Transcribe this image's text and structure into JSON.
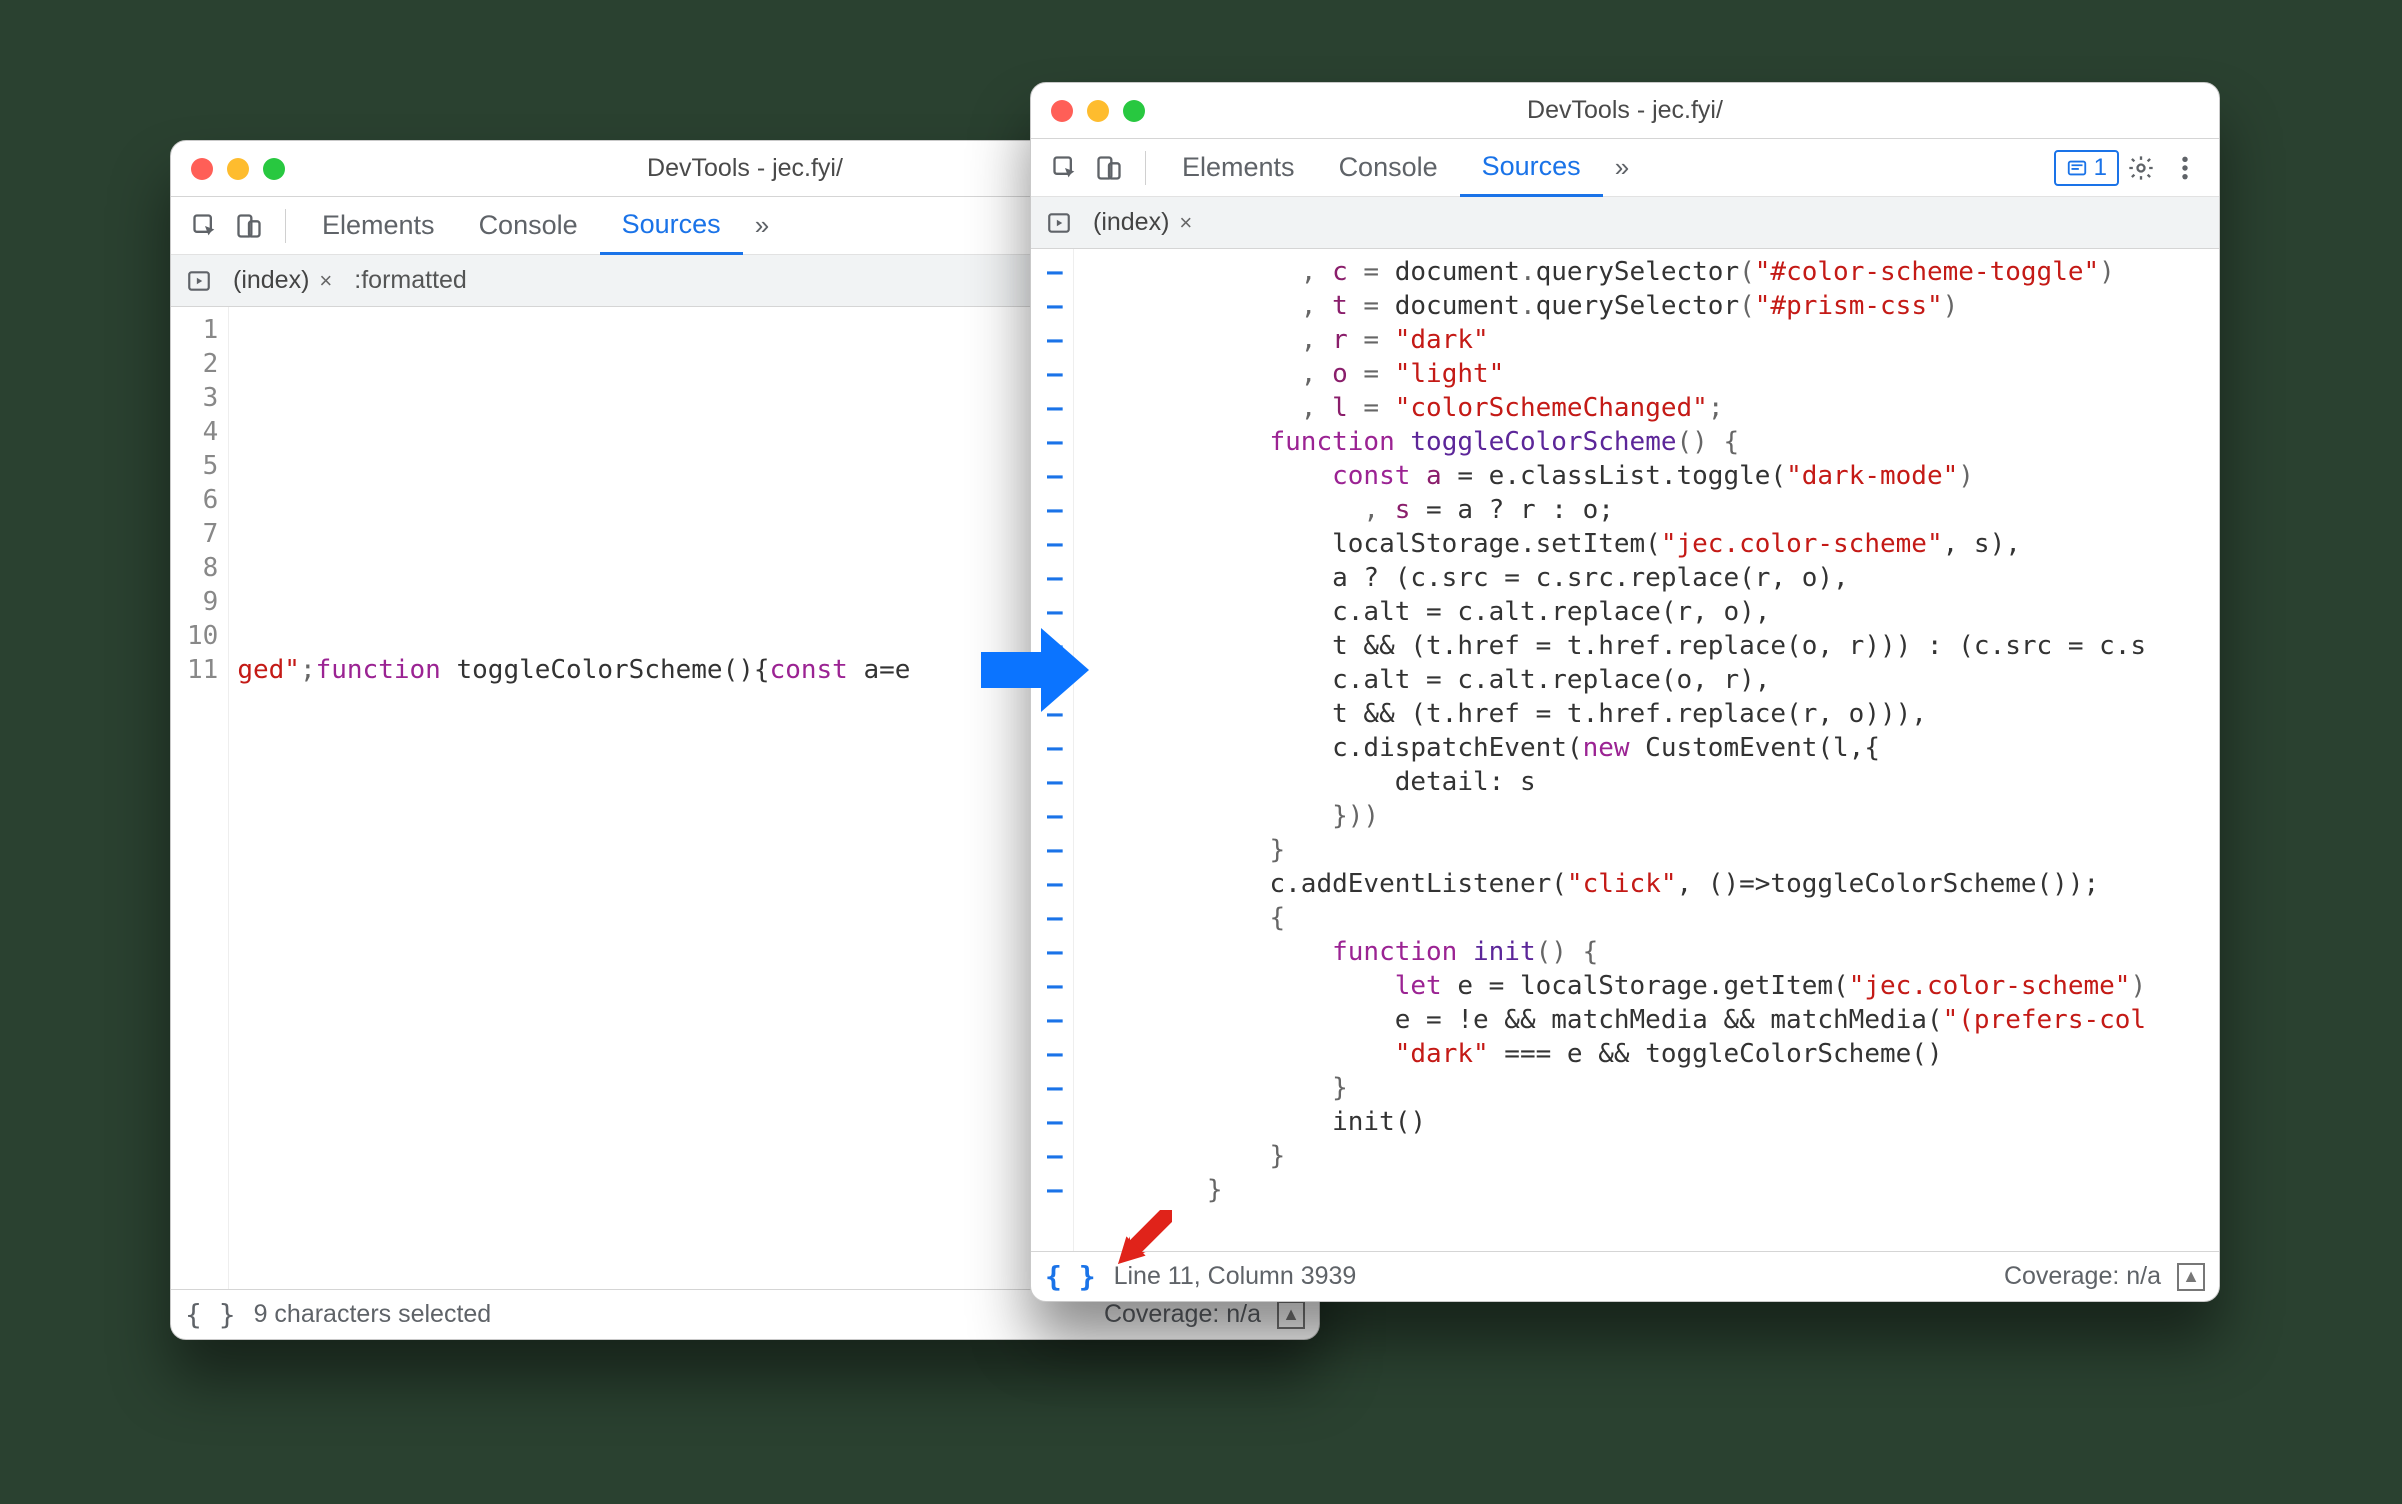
{
  "windowA": {
    "title": "DevTools - jec.fyi/",
    "tabs": {
      "elements": "Elements",
      "console": "Console",
      "sources": "Sources"
    },
    "files": {
      "index": "(index)",
      "formatted": ":formatted"
    },
    "gutter": [
      "1",
      "2",
      "3",
      "4",
      "5",
      "6",
      "7",
      "8",
      "9",
      "10",
      "11"
    ],
    "code_line11": {
      "a": "ged\"",
      "b": ";",
      "c": "function",
      "d": " toggleColorScheme(){",
      "e": "const",
      "f": " a=e"
    },
    "status": {
      "selection": "9 characters selected",
      "coverage": "Coverage: n/a"
    }
  },
  "windowB": {
    "title": "DevTools - jec.fyi/",
    "tabs": {
      "elements": "Elements",
      "console": "Console",
      "sources": "Sources"
    },
    "badge_count": "1",
    "files": {
      "index": "(index)"
    },
    "gutter_dash": "–",
    "code_lines": [
      [
        {
          "t": "              , ",
          "c": "tok-punc"
        },
        {
          "t": "c",
          "c": "tok-prop"
        },
        {
          "t": " = ",
          "c": "tok-punc"
        },
        {
          "t": "document",
          "c": "tok-id"
        },
        {
          "t": ".",
          "c": "tok-punc"
        },
        {
          "t": "querySelector",
          "c": "tok-id"
        },
        {
          "t": "(",
          "c": "tok-punc"
        },
        {
          "t": "\"#color-scheme-toggle\"",
          "c": "tok-str"
        },
        {
          "t": ")",
          "c": "tok-punc"
        }
      ],
      [
        {
          "t": "              , ",
          "c": "tok-punc"
        },
        {
          "t": "t",
          "c": "tok-prop"
        },
        {
          "t": " = ",
          "c": "tok-punc"
        },
        {
          "t": "document",
          "c": "tok-id"
        },
        {
          "t": ".",
          "c": "tok-punc"
        },
        {
          "t": "querySelector",
          "c": "tok-id"
        },
        {
          "t": "(",
          "c": "tok-punc"
        },
        {
          "t": "\"#prism-css\"",
          "c": "tok-str"
        },
        {
          "t": ")",
          "c": "tok-punc"
        }
      ],
      [
        {
          "t": "              , ",
          "c": "tok-punc"
        },
        {
          "t": "r",
          "c": "tok-prop"
        },
        {
          "t": " = ",
          "c": "tok-punc"
        },
        {
          "t": "\"dark\"",
          "c": "tok-str"
        }
      ],
      [
        {
          "t": "              , ",
          "c": "tok-punc"
        },
        {
          "t": "o",
          "c": "tok-prop"
        },
        {
          "t": " = ",
          "c": "tok-punc"
        },
        {
          "t": "\"light\"",
          "c": "tok-str"
        }
      ],
      [
        {
          "t": "              , ",
          "c": "tok-punc"
        },
        {
          "t": "l",
          "c": "tok-prop"
        },
        {
          "t": " = ",
          "c": "tok-punc"
        },
        {
          "t": "\"colorSchemeChanged\"",
          "c": "tok-str"
        },
        {
          "t": ";",
          "c": "tok-punc"
        }
      ],
      [
        {
          "t": "            ",
          "c": "tok-punc"
        },
        {
          "t": "function",
          "c": "tok-kw"
        },
        {
          "t": " ",
          "c": ""
        },
        {
          "t": "toggleColorScheme",
          "c": "tok-fn"
        },
        {
          "t": "() {",
          "c": "tok-punc"
        }
      ],
      [
        {
          "t": "                ",
          "c": ""
        },
        {
          "t": "const",
          "c": "tok-kw"
        },
        {
          "t": " ",
          "c": ""
        },
        {
          "t": "a",
          "c": "tok-prop"
        },
        {
          "t": " = e.classList.toggle(",
          "c": "tok-id"
        },
        {
          "t": "\"dark-mode\"",
          "c": "tok-str"
        },
        {
          "t": ")",
          "c": "tok-punc"
        }
      ],
      [
        {
          "t": "                  , ",
          "c": "tok-punc"
        },
        {
          "t": "s",
          "c": "tok-prop"
        },
        {
          "t": " = a ? r : o;",
          "c": "tok-id"
        }
      ],
      [
        {
          "t": "                localStorage.setItem(",
          "c": "tok-id"
        },
        {
          "t": "\"jec.color-scheme\"",
          "c": "tok-str"
        },
        {
          "t": ", s),",
          "c": "tok-id"
        }
      ],
      [
        {
          "t": "                a ? (c.src = c.src.replace(r, o),",
          "c": "tok-id"
        }
      ],
      [
        {
          "t": "                c.alt = c.alt.replace(r, o),",
          "c": "tok-id"
        }
      ],
      [
        {
          "t": "                t && (t.href = t.href.replace(o, r))) : (c.src = c.s",
          "c": "tok-id"
        }
      ],
      [
        {
          "t": "                c.alt = c.alt.replace(o, r),",
          "c": "tok-id"
        }
      ],
      [
        {
          "t": "                t && (t.href = t.href.replace(r, o))),",
          "c": "tok-id"
        }
      ],
      [
        {
          "t": "                c.dispatchEvent(",
          "c": "tok-id"
        },
        {
          "t": "new",
          "c": "tok-kw"
        },
        {
          "t": " CustomEvent(l,{",
          "c": "tok-id"
        }
      ],
      [
        {
          "t": "                    detail: s",
          "c": "tok-id"
        }
      ],
      [
        {
          "t": "                }))",
          "c": "tok-punc"
        }
      ],
      [
        {
          "t": "            }",
          "c": "tok-punc"
        }
      ],
      [
        {
          "t": "            c.addEventListener(",
          "c": "tok-id"
        },
        {
          "t": "\"click\"",
          "c": "tok-str"
        },
        {
          "t": ", ()=>toggleColorScheme());",
          "c": "tok-id"
        }
      ],
      [
        {
          "t": "            {",
          "c": "tok-punc"
        }
      ],
      [
        {
          "t": "                ",
          "c": ""
        },
        {
          "t": "function",
          "c": "tok-kw"
        },
        {
          "t": " ",
          "c": ""
        },
        {
          "t": "init",
          "c": "tok-fn"
        },
        {
          "t": "() {",
          "c": "tok-punc"
        }
      ],
      [
        {
          "t": "                    ",
          "c": ""
        },
        {
          "t": "let",
          "c": "tok-kw"
        },
        {
          "t": " e = localStorage.getItem(",
          "c": "tok-id"
        },
        {
          "t": "\"jec.color-scheme\"",
          "c": "tok-str"
        },
        {
          "t": ")",
          "c": "tok-punc"
        }
      ],
      [
        {
          "t": "                    e = !e && matchMedia && matchMedia(",
          "c": "tok-id"
        },
        {
          "t": "\"(prefers-col",
          "c": "tok-str"
        }
      ],
      [
        {
          "t": "                    ",
          "c": ""
        },
        {
          "t": "\"dark\"",
          "c": "tok-str"
        },
        {
          "t": " === e && toggleColorScheme()",
          "c": "tok-id"
        }
      ],
      [
        {
          "t": "                }",
          "c": "tok-punc"
        }
      ],
      [
        {
          "t": "                init()",
          "c": "tok-id"
        }
      ],
      [
        {
          "t": "            }",
          "c": "tok-punc"
        }
      ],
      [
        {
          "t": "        }",
          "c": "tok-punc"
        }
      ]
    ],
    "status": {
      "cursor": "Line 11, Column 3939",
      "coverage": "Coverage: n/a"
    }
  }
}
